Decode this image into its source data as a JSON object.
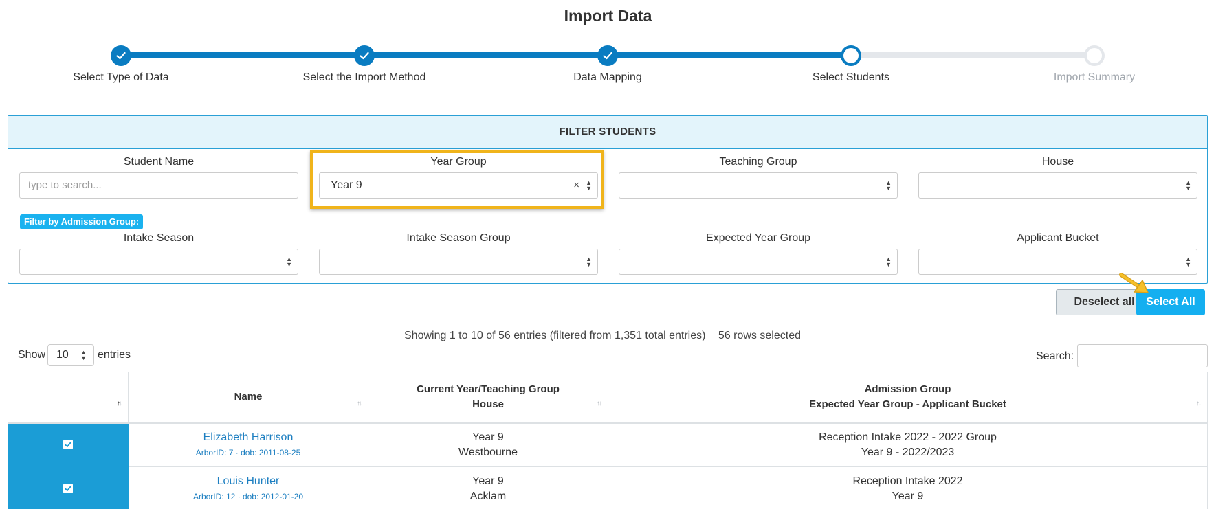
{
  "title": "Import Data",
  "stepper": {
    "steps": [
      {
        "label": "Select Type of Data",
        "state": "done"
      },
      {
        "label": "Select the Import Method",
        "state": "done"
      },
      {
        "label": "Data Mapping",
        "state": "done"
      },
      {
        "label": "Select Students",
        "state": "current"
      },
      {
        "label": "Import Summary",
        "state": "todo"
      }
    ]
  },
  "filter": {
    "header": "FILTER STUDENTS",
    "student_name": {
      "label": "Student Name",
      "placeholder": "type to search..."
    },
    "year_group": {
      "label": "Year Group",
      "value": "Year 9"
    },
    "teaching_group": {
      "label": "Teaching Group",
      "value": ""
    },
    "house": {
      "label": "House",
      "value": ""
    },
    "admission_badge": "Filter by Admission Group:",
    "intake_season": {
      "label": "Intake Season",
      "value": ""
    },
    "intake_season_group": {
      "label": "Intake Season Group",
      "value": ""
    },
    "expected_year_group": {
      "label": "Expected Year Group",
      "value": ""
    },
    "applicant_bucket": {
      "label": "Applicant Bucket",
      "value": ""
    }
  },
  "buttons": {
    "deselect_all": "Deselect all",
    "select_all": "Select All"
  },
  "table_info": {
    "showing": "Showing 1 to 10 of 56 entries (filtered from 1,351 total entries)",
    "rows_selected": "56 rows selected",
    "show_label": "Show",
    "page_size": "10",
    "entries_label": "entries",
    "search_label": "Search:"
  },
  "table": {
    "headers": {
      "name": "Name",
      "current_line1": "Current Year/Teaching Group",
      "current_line2": "House",
      "admission_line1": "Admission Group",
      "admission_line2": "Expected Year Group - Applicant Bucket"
    },
    "rows": [
      {
        "checked": true,
        "name": "Elizabeth Harrison",
        "meta": "ArborID: 7 · dob: 2011-08-25",
        "year": "Year 9",
        "house": "Westbourne",
        "admission_line1": "Reception Intake 2022 - 2022 Group",
        "admission_line2": "Year 9 - 2022/2023"
      },
      {
        "checked": true,
        "name": "Louis Hunter",
        "meta": "ArborID: 12 · dob: 2012-01-20",
        "year": "Year 9",
        "house": "Acklam",
        "admission_line1": "Reception Intake 2022",
        "admission_line2": "Year 9"
      }
    ]
  },
  "colors": {
    "stepper_done": "#0a7cc1",
    "stepper_todo": "#e4e7eb",
    "filter_border": "#2aa0d6",
    "highlight": "#f0b41b",
    "select_all_bg": "#14aff0",
    "checkbox_cell": "#1b9dd6",
    "link": "#1d7fc1"
  }
}
